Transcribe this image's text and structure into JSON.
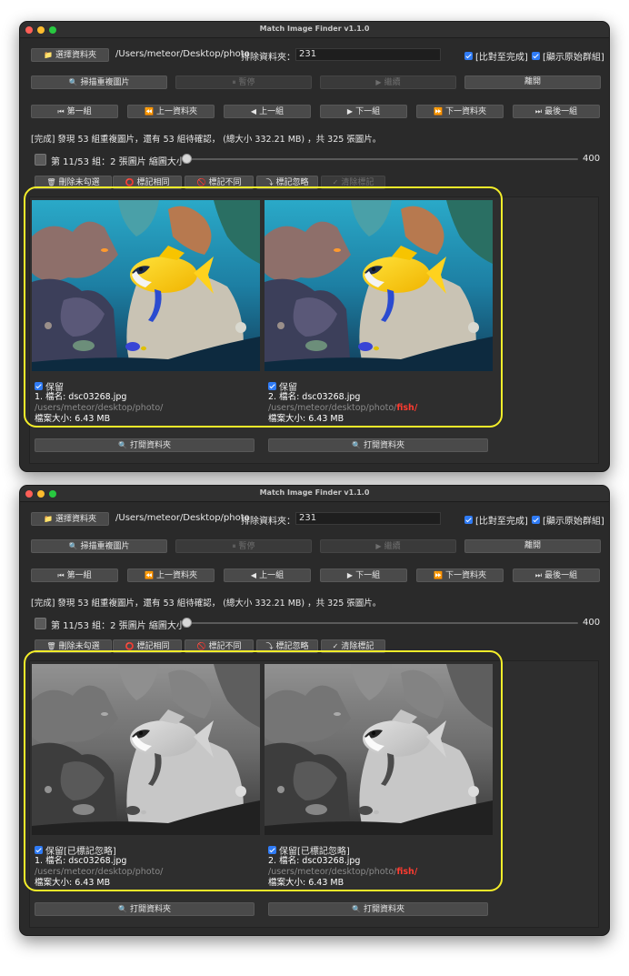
{
  "windows": [
    {
      "title": "Match Image Finder v1.1.0",
      "choose_folder_label": "選擇資料夾",
      "folder_path": "/Users/meteor/Desktop/photo",
      "exclude_label": "排除資料夾：",
      "exclude_value": "231",
      "compare_done_label": "[比對至完成]",
      "show_original_label": "[顯示原始群組]",
      "scan_label": "掃描重複圖片",
      "pause_label": "暫停",
      "continue_label": "繼續",
      "leave_label": "離開",
      "nav": [
        "第一組",
        "上一資料夾",
        "上一組",
        "下一組",
        "下一資料夾",
        "最後一組"
      ],
      "status": "[完成] 發現 53 組重複圖片，還有 53 組待確認， (總大小 332.21 MB) ，共 325 張圖片。",
      "group_info": "第 11/53 組：2 張圖片 縮圖大小",
      "zoom_value": "400",
      "action_buttons": [
        "刪除未勾選",
        "標記相同",
        "標記不同",
        "標記忽略",
        "清除標記"
      ],
      "cards": [
        {
          "keep": "保留",
          "name": "1. 檔名: dsc03268.jpg",
          "path": "/users/meteor/desktop/photo/",
          "path_hl": "",
          "size": "檔案大小: 6.43 MB",
          "open_label": "打開資料夾"
        },
        {
          "keep": "保留",
          "name": "2. 檔名: dsc03268.jpg",
          "path": "/users/meteor/desktop/photo/",
          "path_hl": "fish/",
          "size": "檔案大小: 6.43 MB",
          "open_label": "打開資料夾"
        }
      ]
    },
    {
      "title": "Match Image Finder v1.1.0",
      "choose_folder_label": "選擇資料夾",
      "folder_path": "/Users/meteor/Desktop/photo",
      "exclude_label": "排除資料夾：",
      "exclude_value": "231",
      "compare_done_label": "[比對至完成]",
      "show_original_label": "[顯示原始群組]",
      "scan_label": "掃描重複圖片",
      "pause_label": "暫停",
      "continue_label": "繼續",
      "leave_label": "離開",
      "nav": [
        "第一組",
        "上一資料夾",
        "上一組",
        "下一組",
        "下一資料夾",
        "最後一組"
      ],
      "status": "[完成] 發現 53 組重複圖片，還有 53 組待確認， (總大小 332.21 MB) ，共 325 張圖片。",
      "group_info": "第 11/53 組：2 張圖片 縮圖大小",
      "zoom_value": "400",
      "action_buttons": [
        "刪除未勾選",
        "標記相同",
        "標記不同",
        "標記忽略",
        "清除標記"
      ],
      "cards": [
        {
          "keep": "保留[已標記忽略]",
          "name": "1. 檔名: dsc03268.jpg",
          "path": "/users/meteor/desktop/photo/",
          "path_hl": "",
          "size": "檔案大小: 6.43 MB",
          "open_label": "打開資料夾"
        },
        {
          "keep": "保留[已標記忽略]",
          "name": "2. 檔名: dsc03268.jpg",
          "path": "/users/meteor/desktop/photo/",
          "path_hl": "fish/",
          "size": "檔案大小: 6.43 MB",
          "open_label": "打開資料夾"
        }
      ]
    }
  ],
  "colors": {
    "window_bg": "#2a2a2a",
    "highlight_ring": "#f4ee2a",
    "checkbox_blue": "#2f7bf5",
    "path_highlight": "#ff3b30"
  },
  "icons": [
    "folder-icon",
    "magnifier-icon",
    "pause-icon",
    "play-icon",
    "first-icon",
    "prev-folder-icon",
    "prev-icon",
    "next-icon",
    "next-folder-icon",
    "last-icon",
    "home-icon",
    "trash-icon",
    "same-icon",
    "different-icon",
    "ignore-icon",
    "clear-icon"
  ]
}
